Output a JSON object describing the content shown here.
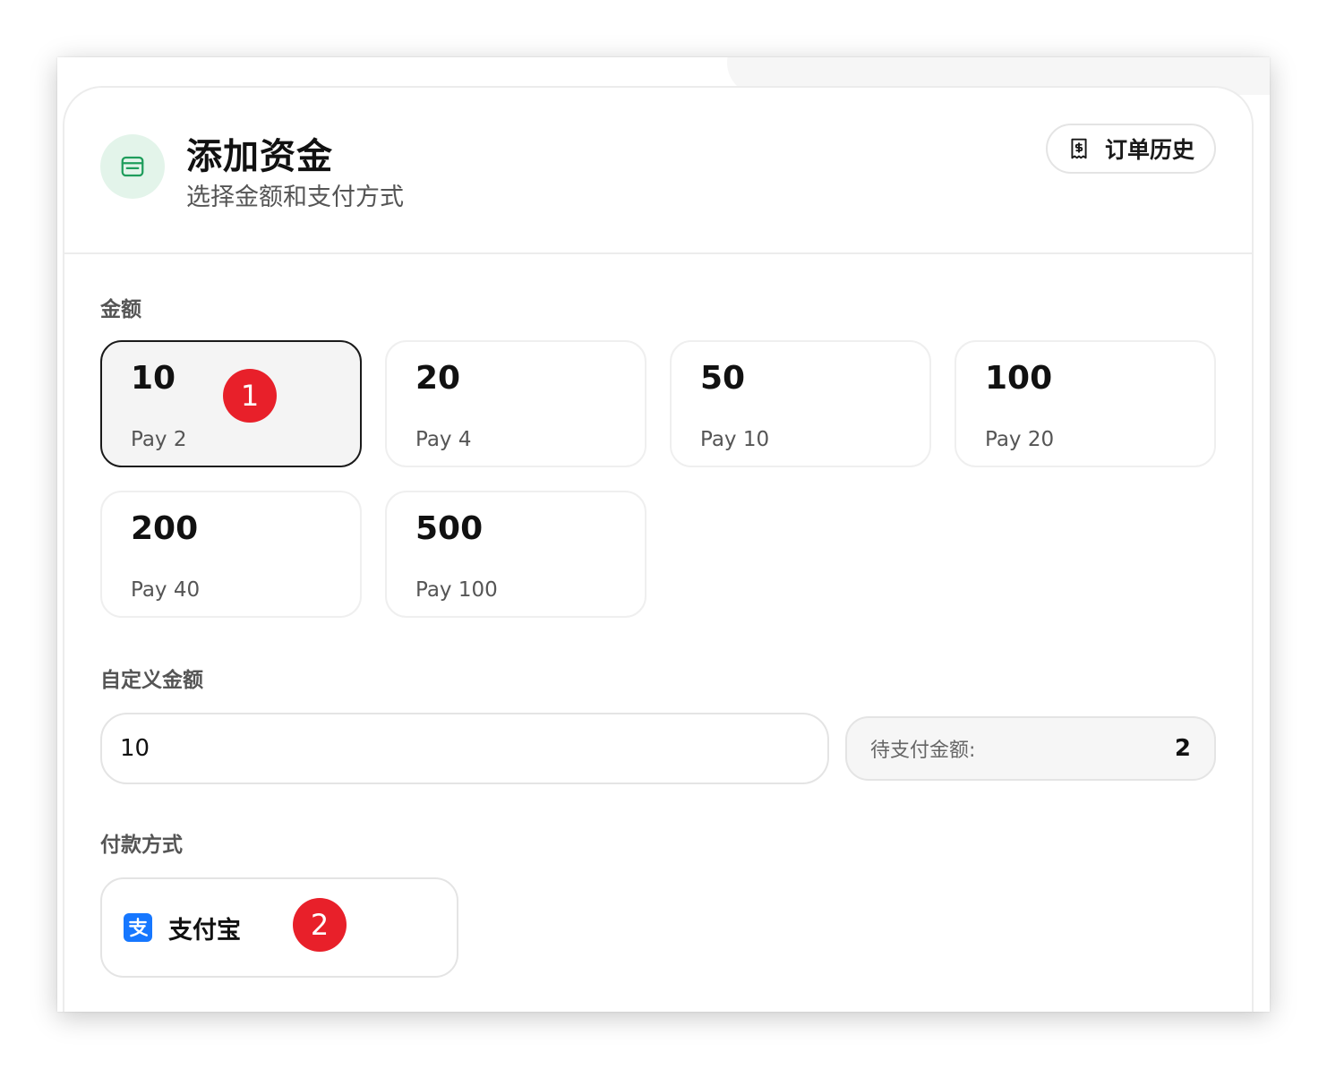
{
  "header": {
    "title": "添加资金",
    "subtitle": "选择金额和支付方式",
    "history_label": "订单历史"
  },
  "amount_section": {
    "label": "金额",
    "options": [
      {
        "amount": "10",
        "pay": "Pay 2",
        "selected": true
      },
      {
        "amount": "20",
        "pay": "Pay 4",
        "selected": false
      },
      {
        "amount": "50",
        "pay": "Pay 10",
        "selected": false
      },
      {
        "amount": "100",
        "pay": "Pay 20",
        "selected": false
      },
      {
        "amount": "200",
        "pay": "Pay 40",
        "selected": false
      },
      {
        "amount": "500",
        "pay": "Pay 100",
        "selected": false
      }
    ]
  },
  "custom_amount": {
    "label": "自定义金额",
    "value": "10",
    "due_label": "待支付金额:",
    "due_value": "2"
  },
  "payment": {
    "label": "付款方式",
    "methods": [
      {
        "name": "支付宝",
        "icon": "alipay-icon"
      }
    ]
  },
  "annotations": [
    {
      "number": "1"
    },
    {
      "number": "2"
    }
  ],
  "colors": {
    "accent_green": "#1f9d5c",
    "wallet_tile_bg": "#e3f4ea",
    "alipay_blue": "#1677ff",
    "marker_red": "#e8202a",
    "selected_border": "#1a1a1a"
  }
}
